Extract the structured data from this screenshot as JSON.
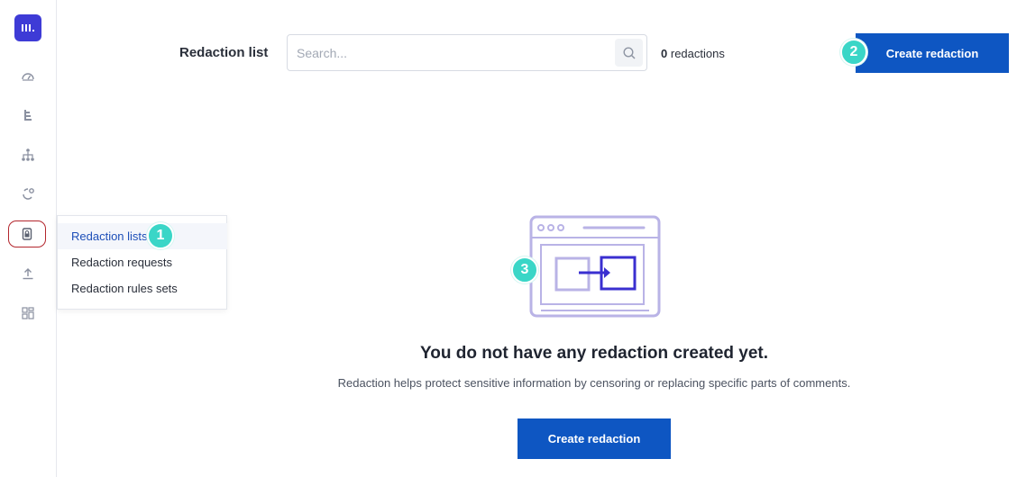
{
  "header": {
    "title": "Redaction list",
    "search_placeholder": "Search...",
    "count_number": "0",
    "count_label": "redactions",
    "create_button": "Create redaction"
  },
  "flyout": {
    "items": [
      {
        "label": "Redaction lists"
      },
      {
        "label": "Redaction requests"
      },
      {
        "label": "Redaction rules sets"
      }
    ]
  },
  "rail": {
    "icons": [
      "logo-icon",
      "dashboard-icon",
      "analytics-icon",
      "hierarchy-icon",
      "integrations-icon",
      "redaction-icon",
      "upload-icon",
      "layout-icon"
    ]
  },
  "badges": [
    "1",
    "2",
    "3"
  ],
  "empty_state": {
    "title": "You do not have any redaction created yet.",
    "description": "Redaction helps protect sensitive information by censoring or replacing specific parts of comments.",
    "button": "Create redaction"
  },
  "colors": {
    "brand": "#3e3bd6",
    "primary_button": "#0e56c2",
    "badge": "#3ad6c7",
    "active_outline": "#b3262d",
    "illustration_light": "#b9b3e6",
    "illustration_dark": "#3a2fd0"
  }
}
